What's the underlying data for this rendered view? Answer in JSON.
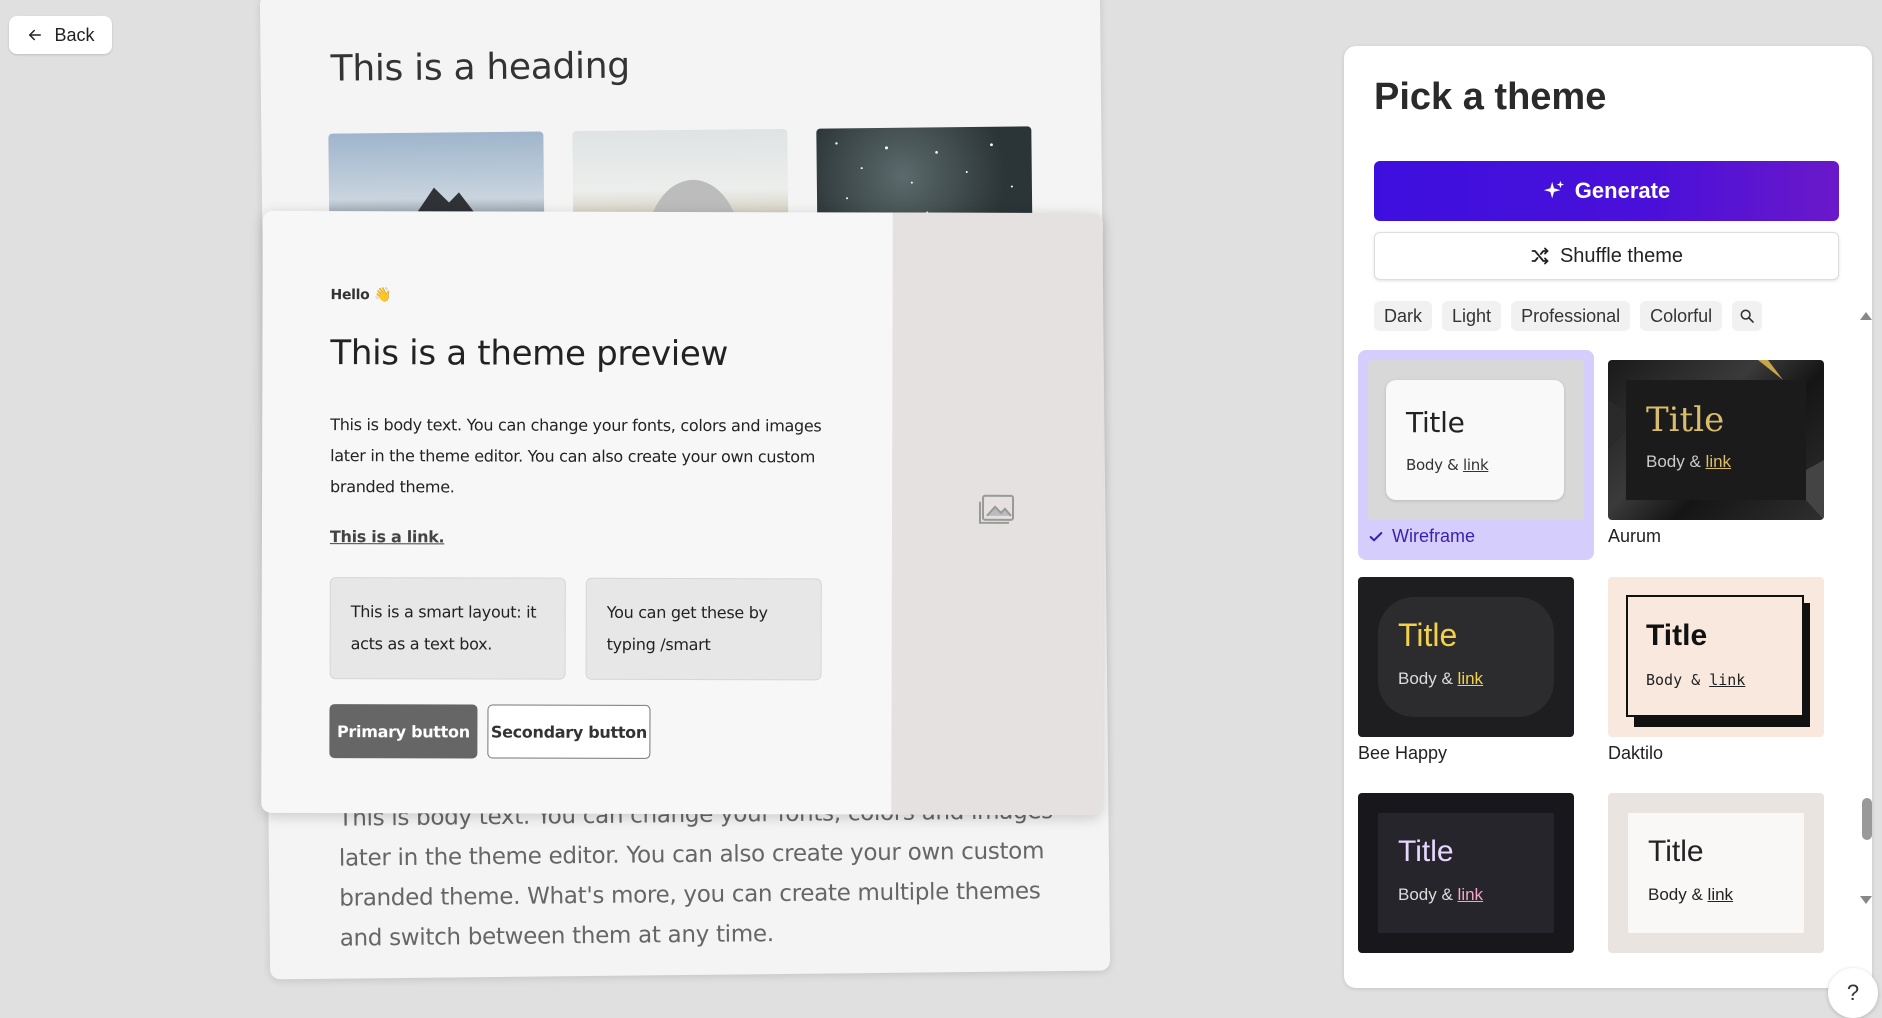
{
  "back": {
    "label": "Back"
  },
  "background_card": {
    "heading": "This is a heading",
    "body": "This is body text. You can change your fonts, colors and images later in the theme editor. You can also create your own custom branded theme. What's more, you can create multiple themes and switch between them at any time."
  },
  "preview": {
    "hello": "Hello 👋",
    "title": "This is a theme preview",
    "body": "This is body text. You can change your fonts, colors and images later in the theme editor. You can also create your own custom branded theme.",
    "link": "This is a link.",
    "smart_box_1": "This is a smart layout: it acts as a text box.",
    "smart_box_2": "You can get these by typing /smart",
    "primary_button": "Primary button",
    "secondary_button": "Secondary button"
  },
  "panel": {
    "title": "Pick a theme",
    "generate": "Generate",
    "shuffle": "Shuffle theme",
    "filters": [
      "Dark",
      "Light",
      "Professional",
      "Colorful"
    ],
    "search_icon": "search-icon",
    "themes": [
      {
        "name": "Wireframe",
        "title": "Title",
        "body": "Body &",
        "link": "link",
        "selected": true
      },
      {
        "name": "Aurum",
        "title": "Title",
        "body": "Body &",
        "link": "link"
      },
      {
        "name": "Bee Happy",
        "title": "Title",
        "body": "Body &",
        "link": "link"
      },
      {
        "name": "Daktilo",
        "title": "Title",
        "body": "Body &",
        "link": "link"
      },
      {
        "name": "",
        "title": "Title",
        "body": "Body &",
        "link": "link"
      },
      {
        "name": "",
        "title": "Title",
        "body": "Body &",
        "link": "link"
      }
    ]
  },
  "help": {
    "label": "?"
  },
  "colors": {
    "accent": "#4a10d9",
    "selected_bg": "#d5cdfb"
  }
}
